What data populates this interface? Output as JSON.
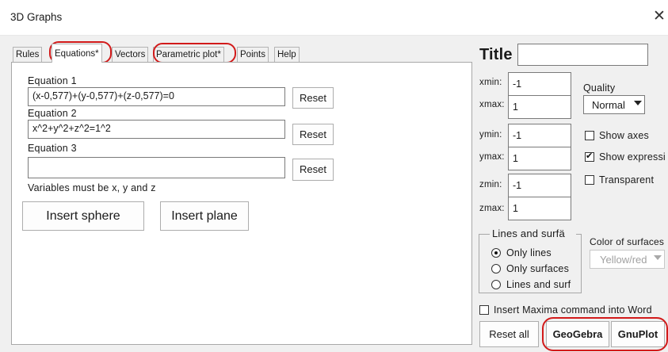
{
  "window": {
    "title": "3D Graphs",
    "close_icon": "close-icon"
  },
  "tabs": [
    {
      "label": "Rules",
      "active": false
    },
    {
      "label": "Equations*",
      "active": true
    },
    {
      "label": "Vectors",
      "active": false
    },
    {
      "label": "Parametric plot*",
      "active": false
    },
    {
      "label": "Points",
      "active": false
    },
    {
      "label": "Help",
      "active": false
    }
  ],
  "equations": {
    "eq1_label": "Equation 1",
    "eq1_value": "(x-0,577)+(y-0,577)+(z-0,577)=0",
    "eq2_label": "Equation 2",
    "eq2_value": "x^2+y^2+z^2=1^2",
    "eq3_label": "Equation 3",
    "eq3_value": "",
    "reset_label": "Reset",
    "note": "Variables must be x, y and z",
    "insert_sphere": "Insert sphere",
    "insert_plane": "Insert plane"
  },
  "title_field": {
    "label": "Title",
    "value": ""
  },
  "ranges": {
    "xmin_label": "xmin:",
    "xmin": "-1",
    "xmax_label": "xmax:",
    "xmax": "1",
    "ymin_label": "ymin:",
    "ymin": "-1",
    "ymax_label": "ymax:",
    "ymax": "1",
    "zmin_label": "zmin:",
    "zmin": "-1",
    "zmax_label": "zmax:",
    "zmax": "1"
  },
  "quality": {
    "label": "Quality",
    "value": "Normal"
  },
  "options": {
    "show_axes": {
      "label": "Show axes",
      "checked": false
    },
    "show_expression": {
      "label": "Show expressi",
      "checked": true
    },
    "transparent": {
      "label": "Transparent",
      "checked": false
    }
  },
  "lines_group": {
    "title": "Lines and surfä",
    "only_lines": "Only lines",
    "only_surfaces": "Only surfaces",
    "lines_and_surfaces": "Lines and surf",
    "selected": "only_lines"
  },
  "color": {
    "label": "Color of surfaces",
    "value": "Yellow/red"
  },
  "maxima": {
    "label": "Insert Maxima command into Word",
    "checked": false
  },
  "buttons": {
    "reset_all": "Reset all",
    "geogebra": "GeoGebra",
    "gnuplot": "GnuPlot"
  },
  "annotation_color": "#d21a1a"
}
